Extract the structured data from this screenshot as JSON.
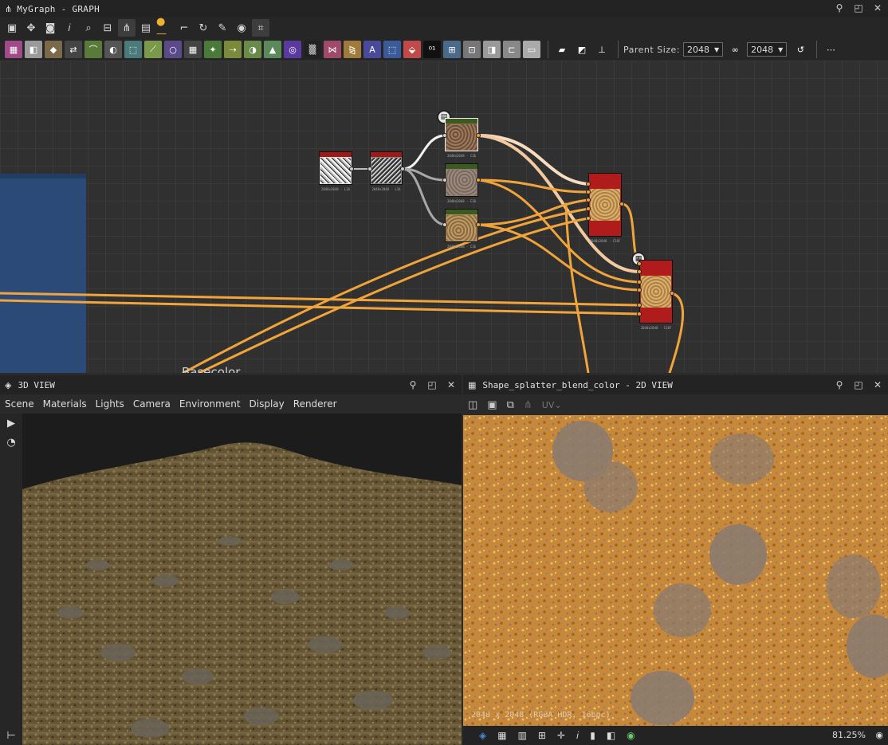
{
  "graph": {
    "title": "MyGraph - GRAPH",
    "parent_size_label": "Parent Size:",
    "parent_size_w": "2048",
    "parent_size_h": "2048",
    "frame_label": "Basecolor",
    "nodes": {
      "n1": "2048x2048 - L16",
      "n2": "2048x2048 - L16",
      "n3": "2048x2048 - C16",
      "n4": "2048x2048 - C16",
      "n5": "2048x2048 - C16",
      "n6": "2048x2048 - C16F",
      "n7": "2048x2048 - C16F"
    }
  },
  "view3d": {
    "title": "3D VIEW",
    "menu": [
      "Scene",
      "Materials",
      "Lights",
      "Camera",
      "Environment",
      "Display",
      "Renderer"
    ]
  },
  "view2d": {
    "title": "Shape_splatter_blend_color - 2D VIEW",
    "uv_label": "UV",
    "resolution_info": "2048 x 2048 (RGBA HDR, 16bpc)",
    "zoom": "81.25%"
  },
  "colors": {
    "wire_orange": "#f0a43a",
    "node_red": "#b01c1c",
    "frame_blue": "#2c4a77"
  }
}
